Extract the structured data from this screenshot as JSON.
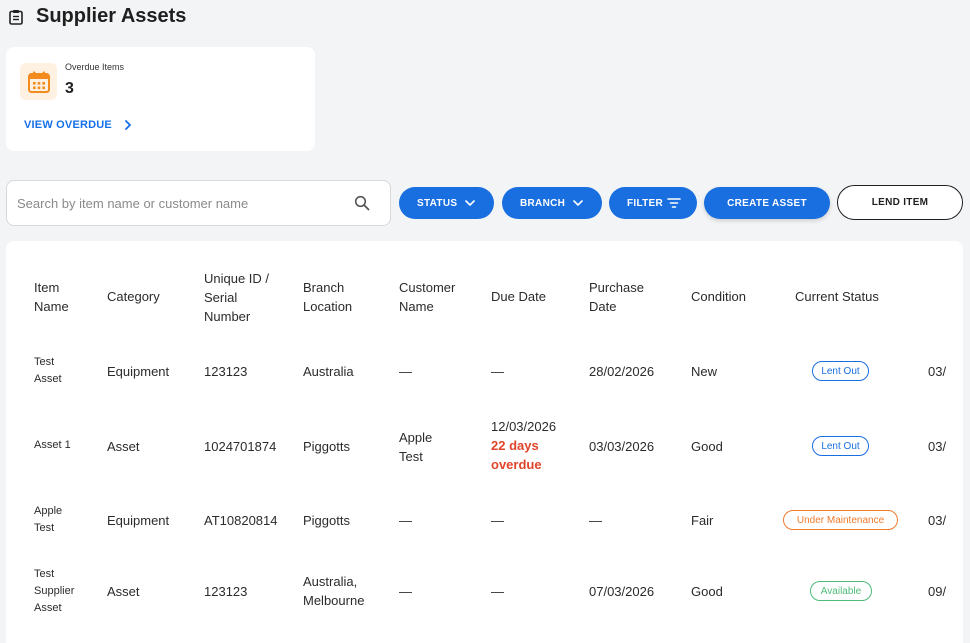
{
  "header": {
    "title": "Supplier Assets",
    "icon": "clipboard-icon"
  },
  "overdue_card": {
    "label": "Overdue Items",
    "value": "3",
    "link": "VIEW OVERDUE",
    "icon": "calendar-icon",
    "accent": "#f28c1f"
  },
  "search": {
    "placeholder": "Search by item name or customer name",
    "value": ""
  },
  "toolbar": {
    "status": "STATUS",
    "branch": "BRANCH",
    "filter": "FILTER",
    "create": "CREATE ASSET",
    "lend": "LEND ITEM"
  },
  "table": {
    "headers": [
      "Item Name",
      "Category",
      "Unique ID / Serial Number",
      "Branch Location",
      "Customer Name",
      "Due Date",
      "Purchase Date",
      "Condition",
      "Current Status"
    ],
    "header_lines": {
      "item": [
        "Item",
        "Name"
      ],
      "category": [
        "Category"
      ],
      "uid": [
        "Unique ID /",
        "Serial",
        "Number"
      ],
      "branch": [
        "Branch",
        "Location"
      ],
      "customer": [
        "Customer",
        "Name"
      ],
      "due": [
        "Due Date"
      ],
      "purchase": [
        "Purchase",
        "Date"
      ],
      "condition": [
        "Condition"
      ],
      "status": [
        "Current Status"
      ]
    },
    "rows": [
      {
        "item": [
          "Test",
          "Asset"
        ],
        "category": "Equipment",
        "uid": "123123",
        "branch": [
          "Australia"
        ],
        "customer": [
          "—"
        ],
        "due": "—",
        "due_overdue": [
          "",
          ""
        ],
        "purchase": "28/02/2026",
        "condition": "New",
        "status": "Lent Out",
        "status_color": "#1a6fe0",
        "extra": "03/"
      },
      {
        "item": [
          "Asset 1"
        ],
        "category": "Asset",
        "uid": "1024701874",
        "branch": [
          "Piggotts"
        ],
        "customer": [
          "Apple",
          "Test"
        ],
        "due": "12/03/2026",
        "due_overdue": [
          "22 days",
          "overdue"
        ],
        "purchase": "03/03/2026",
        "condition": "Good",
        "status": "Lent Out",
        "status_color": "#1a6fe0",
        "extra": "03/"
      },
      {
        "item": [
          "Apple",
          "Test"
        ],
        "category": "Equipment",
        "uid": "AT10820814",
        "branch": [
          "Piggotts"
        ],
        "customer": [
          "—"
        ],
        "due": "—",
        "due_overdue": [
          "",
          ""
        ],
        "purchase": "—",
        "condition": "Fair",
        "status": "Under Maintenance",
        "status_color": "#f07a2c",
        "extra": "03/"
      },
      {
        "item": [
          "Test",
          "Supplier",
          "Asset"
        ],
        "category": "Asset",
        "uid": "123123",
        "branch": [
          "Australia,",
          "Melbourne"
        ],
        "customer": [
          "—"
        ],
        "due": "—",
        "due_overdue": [
          "",
          ""
        ],
        "purchase": "07/03/2026",
        "condition": "Good",
        "status": "Available",
        "status_color": "#4fbb7a",
        "extra": "09/"
      }
    ]
  }
}
